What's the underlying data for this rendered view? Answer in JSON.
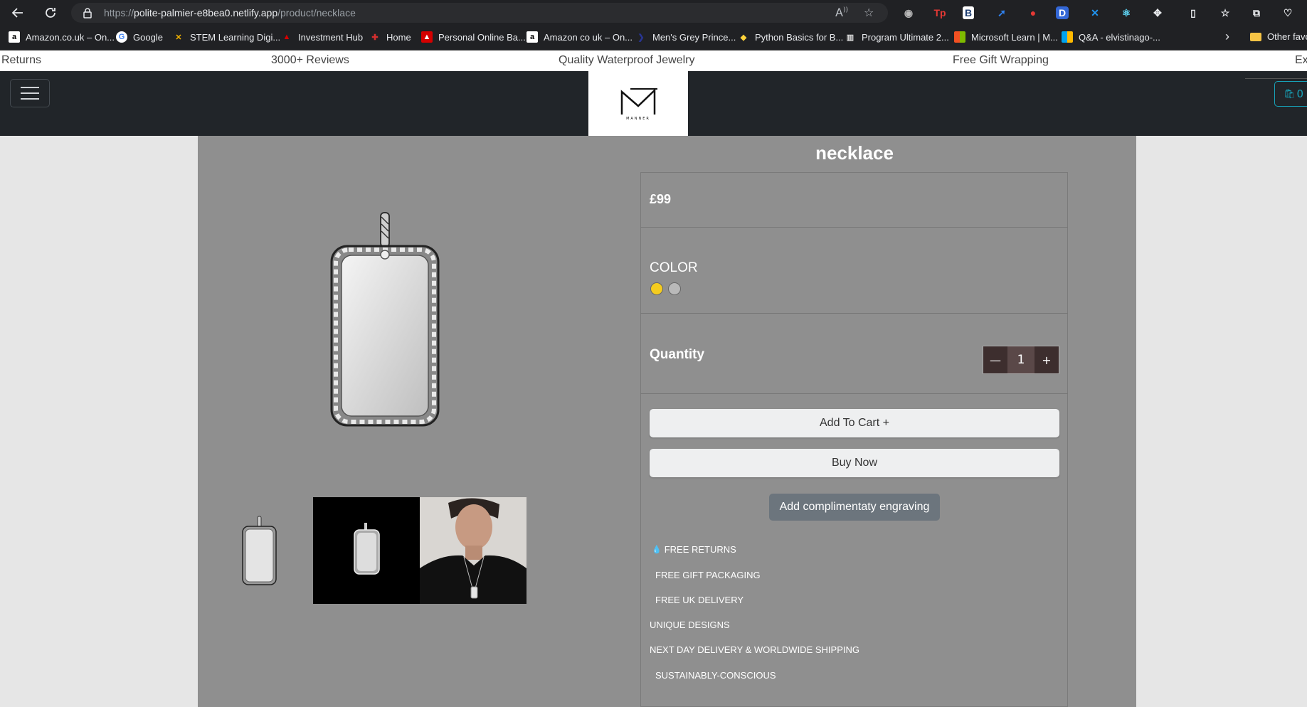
{
  "browser": {
    "url_prefix": "https://",
    "url_host": "polite-palmier-e8bea0.netlify.app",
    "url_path": "/product/necklace"
  },
  "bookmarks": [
    {
      "label": "Amazon.co.uk – On...",
      "icon": "amazon-icon"
    },
    {
      "label": "Google",
      "icon": "google-icon"
    },
    {
      "label": "STEM Learning Digi...",
      "icon": "stem-icon"
    },
    {
      "label": "Investment Hub",
      "icon": "investment-icon"
    },
    {
      "label": "Home",
      "icon": "home-icon"
    },
    {
      "label": "Personal Online Ba...",
      "icon": "bank-icon"
    },
    {
      "label": "Amazon co uk – On...",
      "icon": "amazon-icon"
    },
    {
      "label": "Men's Grey Prince...",
      "icon": "shop-icon"
    },
    {
      "label": "Python Basics for B...",
      "icon": "python-icon"
    },
    {
      "label": "Program Ultimate 2...",
      "icon": "program-icon"
    },
    {
      "label": "Microsoft Learn | M...",
      "icon": "microsoft-icon"
    },
    {
      "label": "Q&A - elvistinago-...",
      "icon": "microsoft-icon"
    },
    {
      "label": "Other favo",
      "icon": "folder-icon"
    }
  ],
  "announce": {
    "items": [
      "Returns",
      "3000+ Reviews",
      "Quality Waterproof Jewelry",
      "Free Gift Wrapping",
      "Exc"
    ]
  },
  "header": {
    "logo_text": "MANNER",
    "cart_count": "0"
  },
  "product": {
    "title": "necklace",
    "price": "£99",
    "color_label": "COLOR",
    "colors": [
      "#f5cc1f",
      "#b9b9b9"
    ],
    "quantity_label": "Quantity",
    "quantity": "1",
    "minus": "—",
    "plus": "+",
    "add_to_cart": "Add To Cart +",
    "buy_now": "Buy Now",
    "engrave": "Add complimentaty engraving",
    "features": [
      "FREE RETURNS",
      "FREE GIFT PACKAGING",
      "FREE UK DELIVERY",
      "UNIQUE DESIGNS",
      "NEXT DAY DELIVERY & WORLDWIDE SHIPPING",
      "SUSTAINABLY-CONSCIOUS"
    ]
  }
}
